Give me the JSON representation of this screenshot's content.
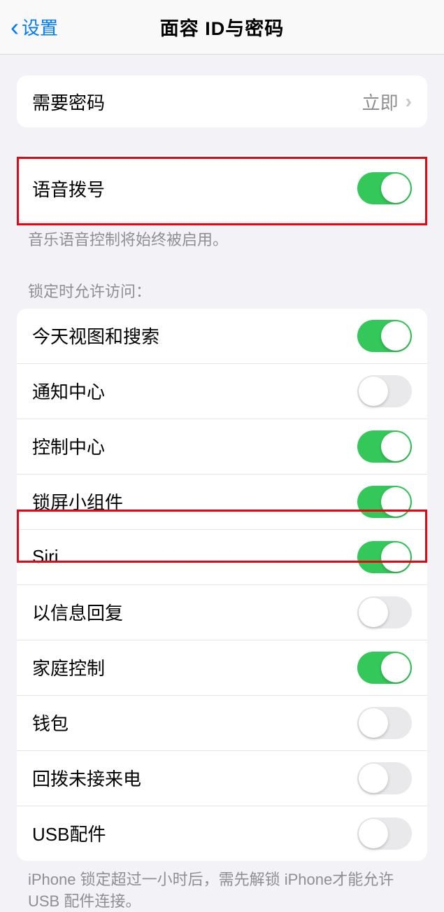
{
  "header": {
    "back_label": "设置",
    "title": "面容 ID与密码"
  },
  "passcode": {
    "label": "需要密码",
    "value": "立即"
  },
  "voice_dial": {
    "label": "语音拨号",
    "enabled": true,
    "footer": "音乐语音控制将始终被启用。"
  },
  "lock_access": {
    "header": "锁定时允许访问：",
    "items": [
      {
        "label": "今天视图和搜索",
        "enabled": true
      },
      {
        "label": "通知中心",
        "enabled": false
      },
      {
        "label": "控制中心",
        "enabled": true
      },
      {
        "label": "锁屏小组件",
        "enabled": true
      },
      {
        "label": "Siri",
        "enabled": true
      },
      {
        "label": "以信息回复",
        "enabled": false
      },
      {
        "label": "家庭控制",
        "enabled": true
      },
      {
        "label": "钱包",
        "enabled": false
      },
      {
        "label": "回拨未接来电",
        "enabled": false
      },
      {
        "label": "USB配件",
        "enabled": false
      }
    ],
    "footer": "iPhone 锁定超过一小时后，需先解锁 iPhone才能允许USB 配件连接。"
  }
}
